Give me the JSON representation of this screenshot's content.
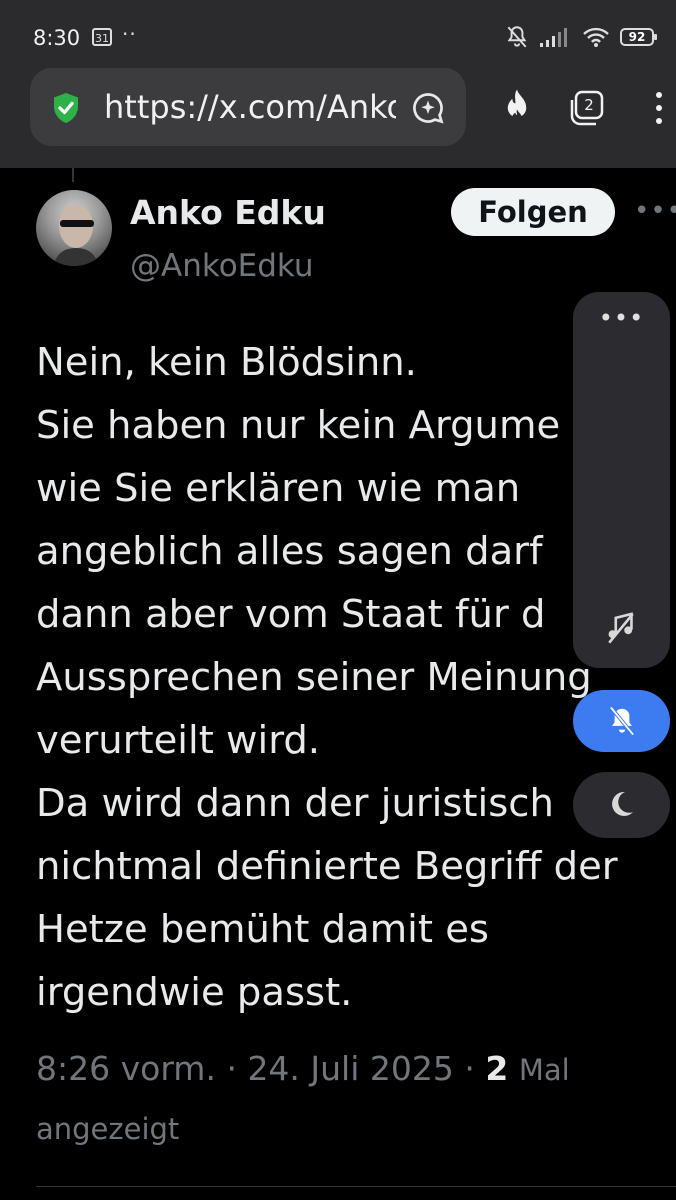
{
  "status_bar": {
    "time": "8:30",
    "calendar_day": "31",
    "battery": "92"
  },
  "browser": {
    "url": "https://x.com/AnkoEdku",
    "tab_count": "2"
  },
  "tweet": {
    "author_name": "Anko Edku",
    "author_handle": "@AnkoEdku",
    "follow_label": "Folgen",
    "lines": [
      "Nein, kein Blödsinn.",
      "Sie haben nur kein Argume",
      "wie Sie erklären wie man",
      "angeblich alles sagen darf",
      "dann aber vom Staat für d",
      "Aussprechen seiner Meinung",
      "verurteilt wird.",
      "Da wird dann der juristisch",
      "nichtmal definierte Begriff der",
      "Hetze bemüht damit es",
      "irgendwie passt."
    ],
    "time": "8:26 vorm.",
    "separator": "·",
    "date": "24. Juli 2025",
    "views_count": "2",
    "views_label_1": "Mal",
    "views_label_2": "angezeigt"
  },
  "colors": {
    "background": "#000000",
    "text_primary": "#e7e9ea",
    "text_secondary": "#71767b",
    "accent_blue": "#3d7bf0",
    "chrome": "#2b2b2d"
  }
}
